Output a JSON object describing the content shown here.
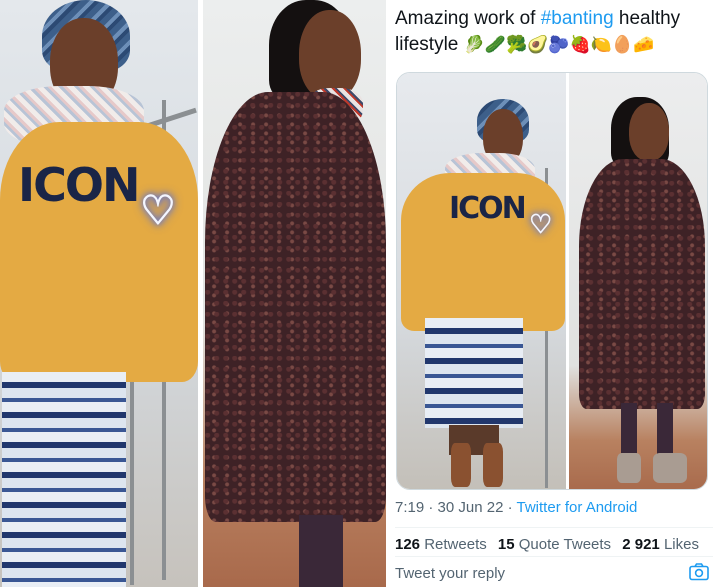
{
  "tweet": {
    "text_prefix": "Amazing work of ",
    "hashtag": "#banting",
    "text_suffix": " healthy lifestyle",
    "emojis": "🥬🥒🥦🥑🫐🍓🍋🥚🧀",
    "time": "7:19",
    "date": "30 Jun 22",
    "source": "Twitter for Android",
    "stats": [
      {
        "count": "126",
        "label": "Retweets"
      },
      {
        "count": "15",
        "label": "Quote Tweets"
      },
      {
        "count": "2 921",
        "label": "Likes"
      }
    ],
    "reply_placeholder": "Tweet your reply"
  },
  "photo_text": {
    "sweater_logo": "ICON",
    "heart_glyph": "♡"
  },
  "icons": {
    "camera": "camera-icon"
  },
  "colors": {
    "accent": "#1d9bf0",
    "muted_text": "#536471",
    "sweater": "#e4aa43",
    "coat": "#3e2226"
  }
}
